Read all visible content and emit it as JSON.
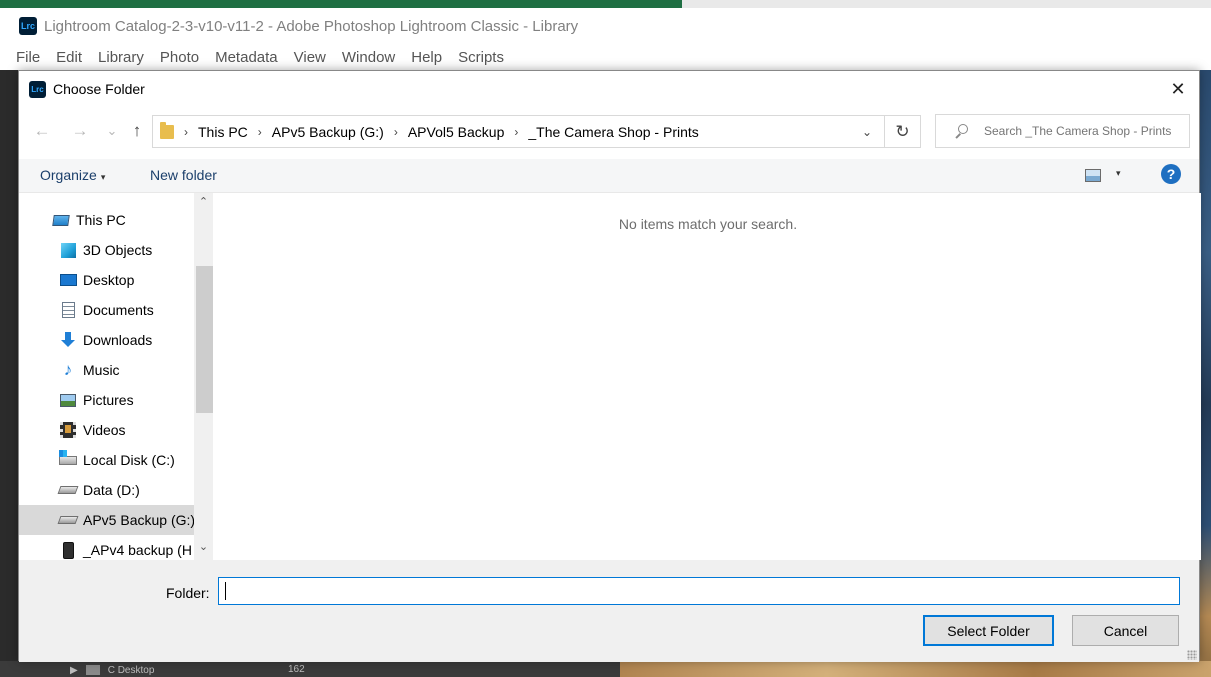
{
  "app": {
    "title": "Lightroom Catalog-2-3-v10-v11-2 - Adobe Photoshop Lightroom Classic - Library",
    "logo_text": "Lrc",
    "menu": [
      "File",
      "Edit",
      "Library",
      "Photo",
      "Metadata",
      "View",
      "Window",
      "Help",
      "Scripts"
    ],
    "background_panel": {
      "folder_name": "C Desktop",
      "count": "162"
    }
  },
  "dialog": {
    "title": "Choose Folder",
    "logo_text": "Lrc",
    "close_glyph": "✕",
    "nav": {
      "back": "←",
      "forward": "→",
      "recent": "⌄",
      "up": "↑"
    },
    "breadcrumbs": [
      "This PC",
      "APv5 Backup (G:)",
      "APVol5 Backup",
      "_The Camera Shop - Prints"
    ],
    "breadcrumb_separator": "›",
    "address_dropdown": "⌄",
    "refresh_glyph": "↻",
    "search": {
      "placeholder": "Search _The Camera Shop - Prints"
    },
    "toolbar": {
      "organize_label": "Organize",
      "organize_caret": "▾",
      "new_folder_label": "New folder",
      "view_caret": "▾",
      "help_label": "?"
    },
    "nav_pane": {
      "items": [
        {
          "label": "This PC",
          "icon": "computer-icon",
          "selected": false
        },
        {
          "label": "3D Objects",
          "icon": "cube-icon",
          "selected": false
        },
        {
          "label": "Desktop",
          "icon": "desktop-icon",
          "selected": false
        },
        {
          "label": "Documents",
          "icon": "document-icon",
          "selected": false
        },
        {
          "label": "Downloads",
          "icon": "download-icon",
          "selected": false
        },
        {
          "label": "Music",
          "icon": "music-note-icon",
          "selected": false
        },
        {
          "label": "Pictures",
          "icon": "picture-icon",
          "selected": false
        },
        {
          "label": "Videos",
          "icon": "video-icon",
          "selected": false
        },
        {
          "label": "Local Disk (C:)",
          "icon": "windows-drive-icon",
          "selected": false
        },
        {
          "label": "Data (D:)",
          "icon": "drive-icon",
          "selected": false
        },
        {
          "label": "APv5 Backup (G:)",
          "icon": "drive-icon",
          "selected": true
        },
        {
          "label": "_APv4 backup (H",
          "icon": "external-drive-icon",
          "selected": false
        }
      ],
      "scroll_up": "⌃",
      "scroll_down": "⌄"
    },
    "content": {
      "empty_message": "No items match your search."
    },
    "folder_field": {
      "label": "Folder:",
      "value": ""
    },
    "buttons": {
      "select_label": "Select Folder",
      "cancel_label": "Cancel"
    }
  },
  "colors": {
    "accent": "#0078d7",
    "link_blue": "#1b3f6b",
    "selected_row": "#d9d9d9",
    "help_blue": "#1e6fc1"
  }
}
